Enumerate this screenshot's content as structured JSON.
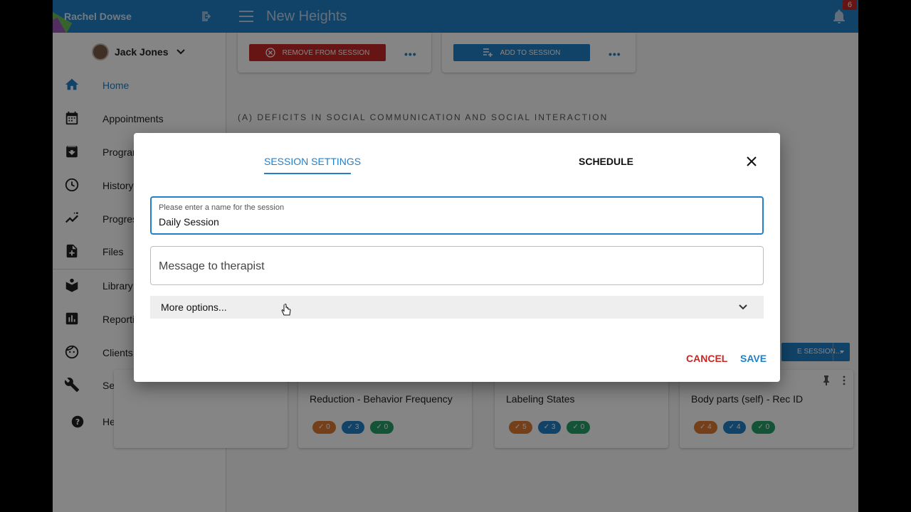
{
  "header": {
    "user_name": "Rachel Dowse",
    "app_title": "New Heights",
    "notification_count": "6"
  },
  "sidebar": {
    "client_name": "Jack Jones",
    "items": [
      {
        "label": "Home",
        "icon": "home-icon"
      },
      {
        "label": "Appointments",
        "icon": "calendar-icon"
      },
      {
        "label": "Programs",
        "icon": "archive-icon"
      },
      {
        "label": "History",
        "icon": "clock-icon"
      },
      {
        "label": "Progress",
        "icon": "trend-icon"
      },
      {
        "label": "Files",
        "icon": "file-add-icon"
      },
      {
        "label": "Library",
        "icon": "book-icon"
      },
      {
        "label": "Reporting",
        "icon": "bar-chart-icon"
      },
      {
        "label": "Clients",
        "icon": "face-icon"
      },
      {
        "label": "Settings",
        "icon": "wrench-icon"
      },
      {
        "label": "Help",
        "icon": "help-icon"
      }
    ]
  },
  "content": {
    "remove_label": "REMOVE FROM SESSION",
    "add_label": "ADD TO SESSION",
    "section_heading": "(A) DEFICITS IN SOCIAL COMMUNICATION AND SOCIAL INTERACTION",
    "split_label": "E SESSION...",
    "cards": [
      {
        "title": "Reduction - Behavior Frequency",
        "counts": [
          "0",
          "3",
          "0"
        ]
      },
      {
        "title": "Labeling States",
        "counts": [
          "5",
          "3",
          "0"
        ]
      },
      {
        "title": "Body parts (self) - Rec ID",
        "counts": [
          "4",
          "4",
          "0"
        ]
      }
    ]
  },
  "dialog": {
    "tab_session": "SESSION SETTINGS",
    "tab_schedule": "SCHEDULE",
    "name_label": "Please enter a name for the session",
    "name_value": "Daily Session",
    "message_placeholder": "Message to therapist",
    "more_options": "More options...",
    "cancel": "CANCEL",
    "save": "SAVE"
  },
  "colors": {
    "primary": "#2180c8",
    "danger": "#c62828",
    "orange": "#e07a30",
    "green": "#26a269"
  }
}
